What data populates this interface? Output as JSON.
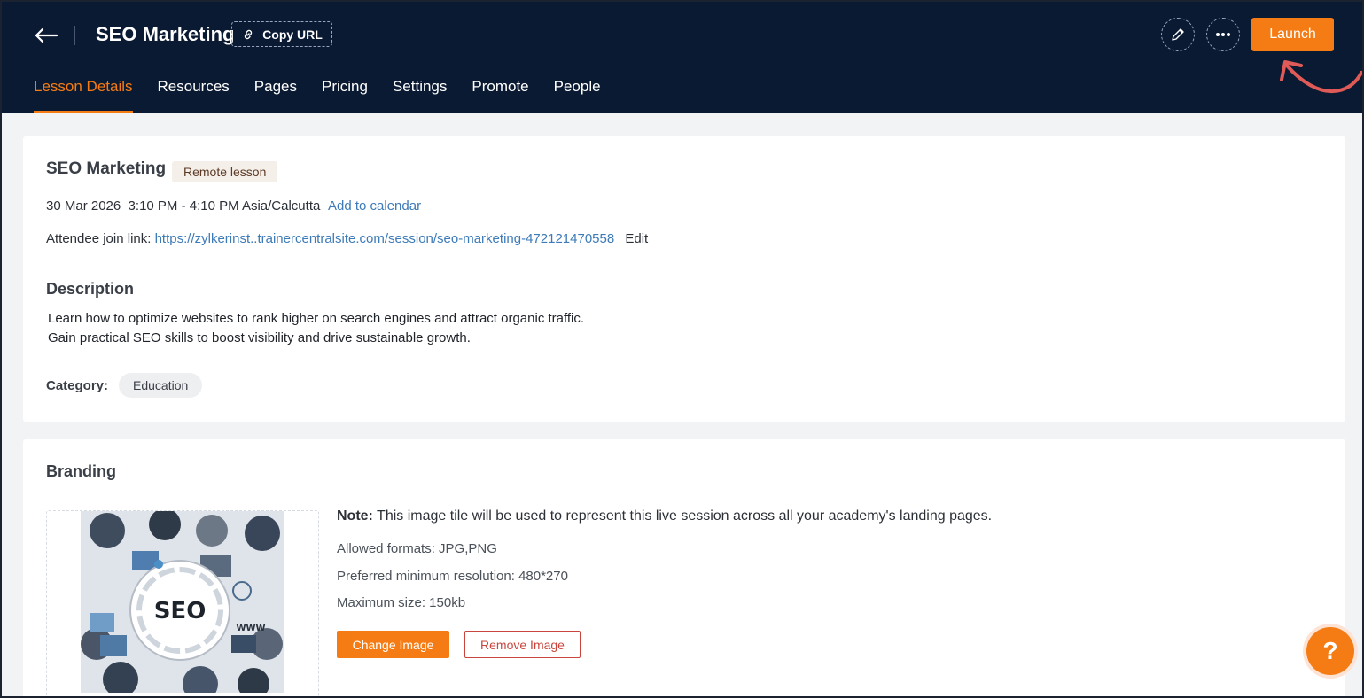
{
  "header": {
    "title": "SEO Marketing",
    "copy_url_label": "Copy URL",
    "launch_label": "Launch"
  },
  "tabs": [
    {
      "label": "Lesson Details",
      "active": true
    },
    {
      "label": "Resources"
    },
    {
      "label": "Pages"
    },
    {
      "label": "Pricing"
    },
    {
      "label": "Settings"
    },
    {
      "label": "Promote"
    },
    {
      "label": "People"
    }
  ],
  "lesson": {
    "title": "SEO Marketing",
    "badge": "Remote lesson",
    "datetime": "30 Mar 2026  3:10 PM - 4:10 PM Asia/Calcutta",
    "add_calendar": "Add to calendar",
    "join_label": "Attendee join link:",
    "join_url": "https://zylkerinst..trainercentralsite.com/session/seo-marketing-472121470558",
    "join_edit": "Edit",
    "description_heading": "Description",
    "description_line1": "Learn how to optimize websites to rank higher on search engines and attract organic traffic.",
    "description_line2": "Gain practical SEO skills to boost visibility and drive sustainable growth.",
    "category_label": "Category:",
    "category_value": "Education"
  },
  "branding": {
    "heading": "Branding",
    "image_text": "SEO",
    "image_subtext": "WWW",
    "note_bold": "Note:",
    "note_text": " This image tile will be used to represent this live session across all your academy's landing pages.",
    "allowed_formats": "Allowed formats: JPG,PNG",
    "min_resolution": "Preferred minimum resolution: 480*270",
    "max_size": "Maximum size: 150kb",
    "change_label": "Change Image",
    "remove_label": "Remove Image"
  },
  "help": {
    "label": "?"
  },
  "colors": {
    "header_bg": "#0b1a33",
    "accent": "#f57c14",
    "link": "#3c7ab8",
    "danger": "#c8463d"
  }
}
